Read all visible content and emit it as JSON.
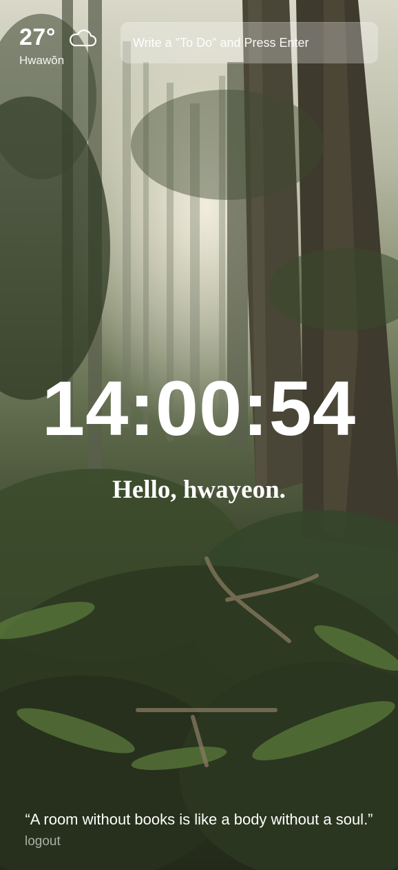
{
  "weather": {
    "temperature": "27°",
    "condition_icon": "cloud-icon",
    "location": "Hwawŏn"
  },
  "todo": {
    "placeholder": "Write a \"To Do\" and Press Enter",
    "value": ""
  },
  "clock": {
    "time": "14:00:54"
  },
  "greeting": {
    "text": "Hello, hwayeon."
  },
  "quote": {
    "text": "“A room without books is like a body without a soul.”"
  },
  "auth": {
    "logout_label": "logout"
  }
}
